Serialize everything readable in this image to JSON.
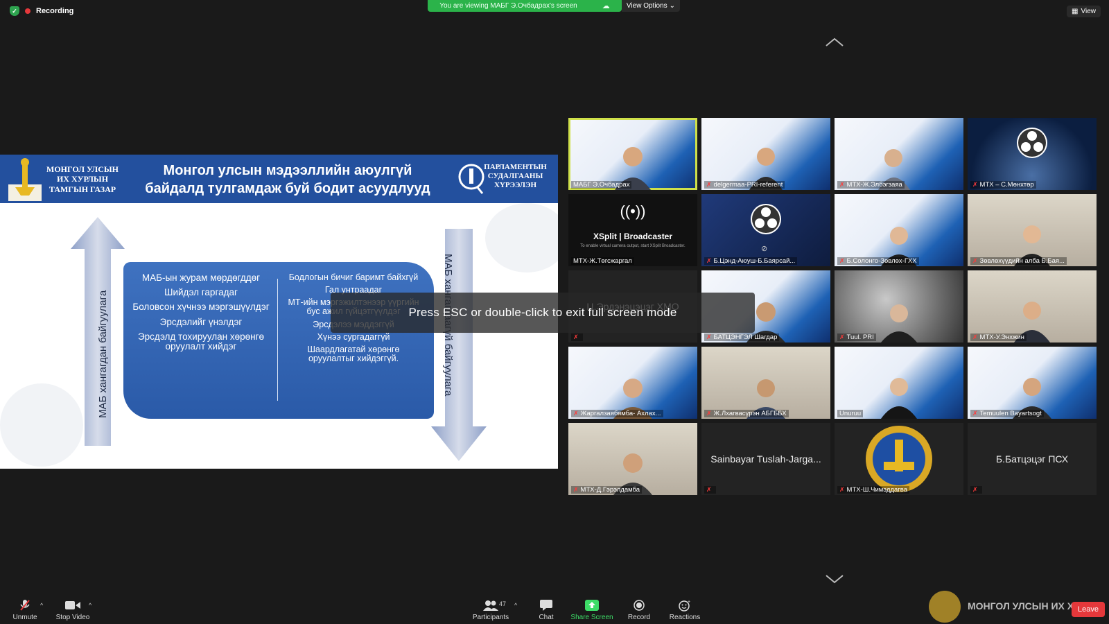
{
  "top": {
    "recording_label": "Recording",
    "viewing_label": "You are viewing МАБГ Э.Очбадрах's screen",
    "view_options_label": "View Options",
    "view_label": "View"
  },
  "slide": {
    "org_left": "МОНГОЛ УЛСЫН\nИХ ХУРЛЫН\nТАМГЫН ГАЗАР",
    "title_line1": "Монгол улсын мэдээллийн аюулгүй",
    "title_line2": "байдалд тулгамдаж буй бодит асуудлууд",
    "org_right": "ПАРЛАМЕНТЫН\nСУДАЛГААНЫ\nХҮРЭЭЛЭН",
    "arrow_up_text": "МАБ хангагдан байгуулагa",
    "arrow_down_text": "МАБ хангагдаагүй байгуулага",
    "left_items": [
      "МАБ-ын журам мөрдөгддөг",
      "Шийдэл гаргадаг",
      "Боловсон хүчнээ мэргэшүүлдэг",
      "Эрсдэлийг үнэлдэг",
      "Эрсдэлд тохируулан хөрөнгө оруулалт хийдэг"
    ],
    "right_items": [
      "Бодлогын бичиг баримт байхгүй",
      "Гал унтраадаг",
      "МТ-ийн мэргэжилтэнээр үүргийн бус ажил гүйцэтгүүлдэг",
      "Эрсдэлээ мэддэггүй",
      "Хүнээ сургадаггүй",
      "Шаардлагатай хөрөнгө оруулалтыг хийдэггүй."
    ],
    "esc_message": "Press ESC or double-click to exit full screen mode"
  },
  "participants": [
    {
      "name": "МАБГ Э.Очбадрах",
      "muted": false
    },
    {
      "name": "delgermaa-PRI-referent",
      "muted": true
    },
    {
      "name": "МТХ-Ж.Элбэгзаяа",
      "muted": true
    },
    {
      "name": "МТХ – С.Мөнхтөр",
      "muted": true
    },
    {
      "name": "МТХ-Ж.Төгсжаргал",
      "muted": false
    },
    {
      "name": "Б.Цэнд-Аюуш-Б.Баярсай...",
      "muted": true
    },
    {
      "name": "Б.Солонго-Зөвлөх-ГХХ",
      "muted": true
    },
    {
      "name": "Зөвлөхүүдийн алба Б.Бая...",
      "muted": true
    },
    {
      "name": "",
      "muted": true
    },
    {
      "name": "БАТЦЭНГЭЛ Шагдар",
      "muted": true
    },
    {
      "name": "Tuul. PRI",
      "muted": true
    },
    {
      "name": "МТХ-У.Энхжин",
      "muted": true
    },
    {
      "name": "Жаргалзаябямба- Ахлах...",
      "muted": true
    },
    {
      "name": "Ж.Лхагвасүрэн АБГББХ",
      "muted": true
    },
    {
      "name": "Unuruu",
      "muted": false
    },
    {
      "name": "Temuulen Bayartsogt",
      "muted": true
    },
    {
      "name": "МТХ-Д.Гэрэлдамба",
      "muted": true
    },
    {
      "name": "",
      "muted": true
    },
    {
      "name": "МТХ-Ш.Чимэддагва",
      "muted": true
    },
    {
      "name": "",
      "muted": true
    }
  ],
  "big_names": {
    "tile9": "Ц.Эрдэнэцэцэг ХМО",
    "tile18": "Sainbayar Tuslah-Jarga...",
    "tile20": "Б.Батцэцэг ПСХ"
  },
  "xsplit": {
    "brand": "XSplit | Broadcaster",
    "hint": "To enable virtual camera output, start XSplit Broadcaster."
  },
  "toolbar": {
    "unmute": "Unmute",
    "stop_video": "Stop Video",
    "participants": "Participants",
    "participant_count": "47",
    "chat": "Chat",
    "share_screen": "Share Screen",
    "record": "Record",
    "reactions": "Reactions",
    "leave": "Leave",
    "watermark": "МОНГОЛ УЛСЫН ИХ ХУРАЛ"
  },
  "colors": {
    "accent_green": "#2bb34a",
    "slide_blue": "#23509e",
    "leave_red": "#e5383b"
  }
}
